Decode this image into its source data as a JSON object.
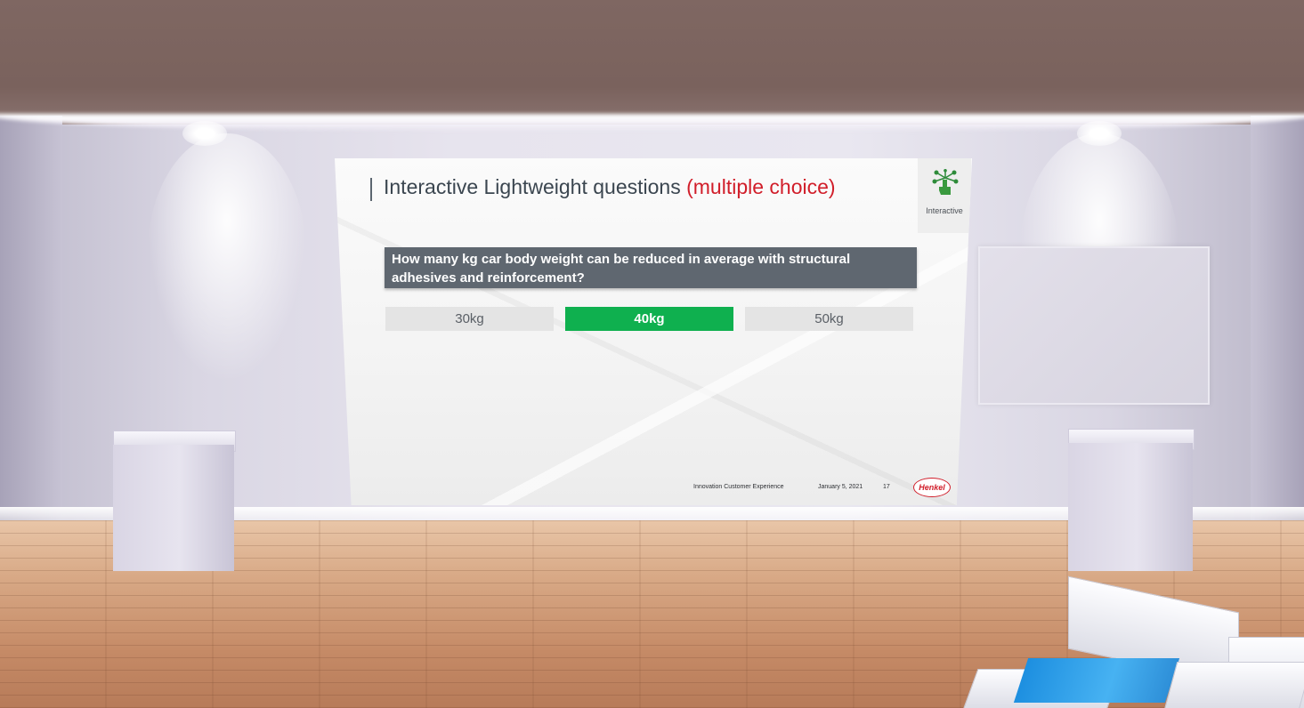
{
  "slide": {
    "title_main": "Interactive Lightweight questions",
    "title_accent": "(multiple choice)",
    "badge_label": "Interactive",
    "question": "How many kg car body weight can be reduced in average with structural adhesives and reinforcement?",
    "options": [
      {
        "label": "30kg",
        "selected": false
      },
      {
        "label": "40kg",
        "selected": true
      },
      {
        "label": "50kg",
        "selected": false
      }
    ],
    "footer": {
      "event": "Innovation Customer Experience",
      "date": "January 5, 2021",
      "page": "17",
      "logo": "Henkel"
    }
  },
  "colors": {
    "correct_answer": "#0fb04f",
    "question_bar": "#5f6770",
    "title_accent": "#d11e2a",
    "icon_green": "#2e8b3a"
  },
  "icons": {
    "badge": "touch-hand-network-icon"
  }
}
